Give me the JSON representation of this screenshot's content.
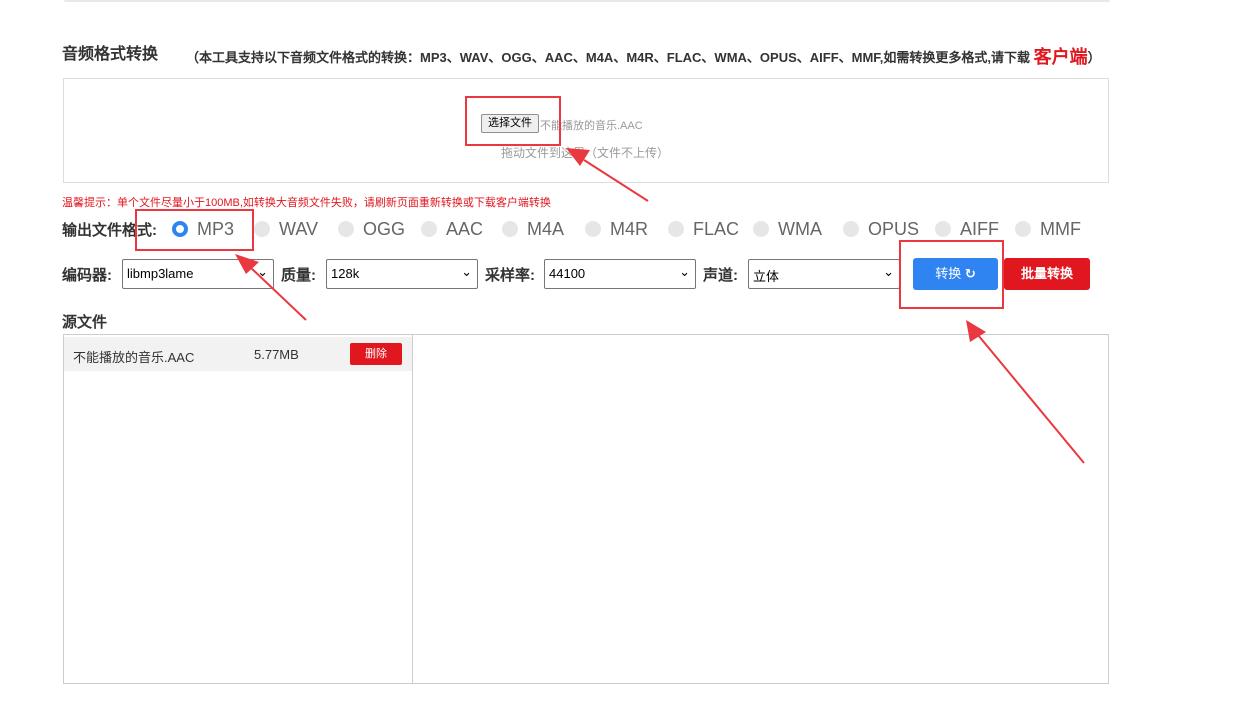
{
  "header": {
    "title": "音频格式转换",
    "description": "（本工具支持以下音频文件格式的转换：MP3、WAV、OGG、AAC、M4A、M4R、FLAC、WMA、OPUS、AIFF、MMF,如需转换更多格式,请下载",
    "client_link": "客户端",
    "close_paren": "）"
  },
  "upload": {
    "choose_button": "选择文件",
    "selected_file": "不能播放的音乐.AAC",
    "drop_hint": "拖动文件到这里（文件不上传）"
  },
  "tip": "温馨提示：单个文件尽量小于100MB,如转换大音频文件失败，请刷新页面重新转换或下载客户端转换",
  "output_format": {
    "label": "输出文件格式:",
    "options": [
      "MP3",
      "WAV",
      "OGG",
      "AAC",
      "M4A",
      "M4R",
      "FLAC",
      "WMA",
      "OPUS",
      "AIFF",
      "MMF"
    ],
    "selected": "MP3"
  },
  "controls": {
    "encoder_label": "编码器:",
    "encoder_value": "libmp3lame",
    "quality_label": "质量:",
    "quality_value": "128k",
    "samplerate_label": "采样率:",
    "samplerate_value": "44100",
    "channel_label": "声道:",
    "channel_value": "立体",
    "convert_button": "转换",
    "batch_button": "批量转换"
  },
  "source": {
    "title": "源文件",
    "files": [
      {
        "name": "不能播放的音乐.AAC",
        "size": "5.77MB",
        "delete_label": "删除"
      }
    ]
  },
  "colors": {
    "accent_blue": "#2f84f2",
    "accent_red": "#e0171f",
    "annotation_red": "#e9383f"
  }
}
